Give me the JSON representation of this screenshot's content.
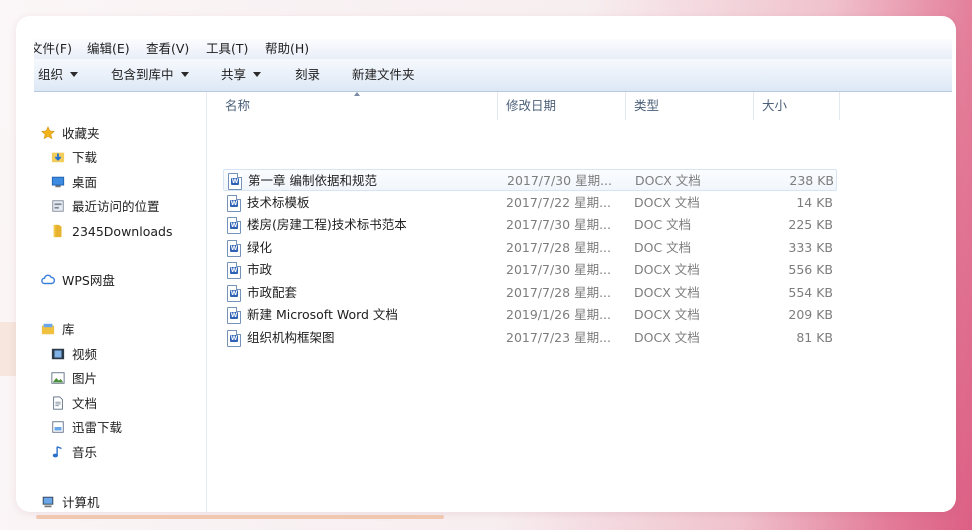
{
  "menu": [
    "文件(F)",
    "编辑(E)",
    "查看(V)",
    "工具(T)",
    "帮助(H)"
  ],
  "toolbar": {
    "organize": "组织",
    "include_library": "包含到库中",
    "share": "共享",
    "burn": "刻录",
    "new_folder": "新建文件夹"
  },
  "nav": {
    "favorites": "收藏夹",
    "downloads": "下载",
    "desktop": "桌面",
    "recent": "最近访问的位置",
    "downloads2345": "2345Downloads",
    "wps": "WPS网盘",
    "library": "库",
    "video": "视频",
    "pictures": "图片",
    "documents": "文档",
    "thunder": "迅雷下载",
    "music": "音乐",
    "computer": "计算机"
  },
  "columns": {
    "name": "名称",
    "date": "修改日期",
    "type": "类型",
    "size": "大小"
  },
  "files": [
    {
      "name": "第一章 编制依据和规范",
      "date": "2017/7/30 星期...",
      "type": "DOCX 文档",
      "size": "238 KB"
    },
    {
      "name": "技术标模板",
      "date": "2017/7/22 星期...",
      "type": "DOCX 文档",
      "size": "14 KB"
    },
    {
      "name": "楼房(房建工程)技术标书范本",
      "date": "2017/7/30 星期...",
      "type": "DOC 文档",
      "size": "225 KB"
    },
    {
      "name": "绿化",
      "date": "2017/7/28 星期...",
      "type": "DOC 文档",
      "size": "333 KB"
    },
    {
      "name": "市政",
      "date": "2017/7/30 星期...",
      "type": "DOCX 文档",
      "size": "556 KB"
    },
    {
      "name": "市政配套",
      "date": "2017/7/28 星期...",
      "type": "DOCX 文档",
      "size": "554 KB"
    },
    {
      "name": "新建 Microsoft Word 文档",
      "date": "2019/1/26 星期...",
      "type": "DOCX 文档",
      "size": "209 KB"
    },
    {
      "name": "组织机构框架图",
      "date": "2017/7/23 星期...",
      "type": "DOCX 文档",
      "size": "81 KB"
    }
  ],
  "colors": {
    "accent": "#2f62b5",
    "selection": "#f1f6fc",
    "header_text": "#4c607a"
  }
}
